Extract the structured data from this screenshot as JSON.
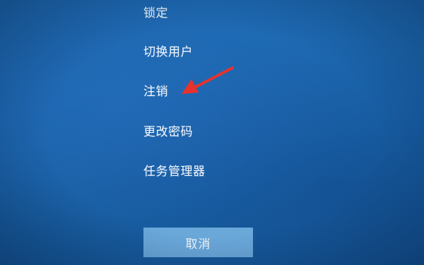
{
  "menu": {
    "items": [
      {
        "label": "锁定"
      },
      {
        "label": "切换用户"
      },
      {
        "label": "注销"
      },
      {
        "label": "更改密码"
      },
      {
        "label": "任务管理器"
      }
    ]
  },
  "cancel": {
    "label": "取消"
  },
  "colors": {
    "background": "#1a64ab",
    "button": "#6aa8da",
    "text": "#eef4fb",
    "arrow": "#e8322c"
  },
  "annotation": {
    "icon": "red-arrow-icon"
  }
}
